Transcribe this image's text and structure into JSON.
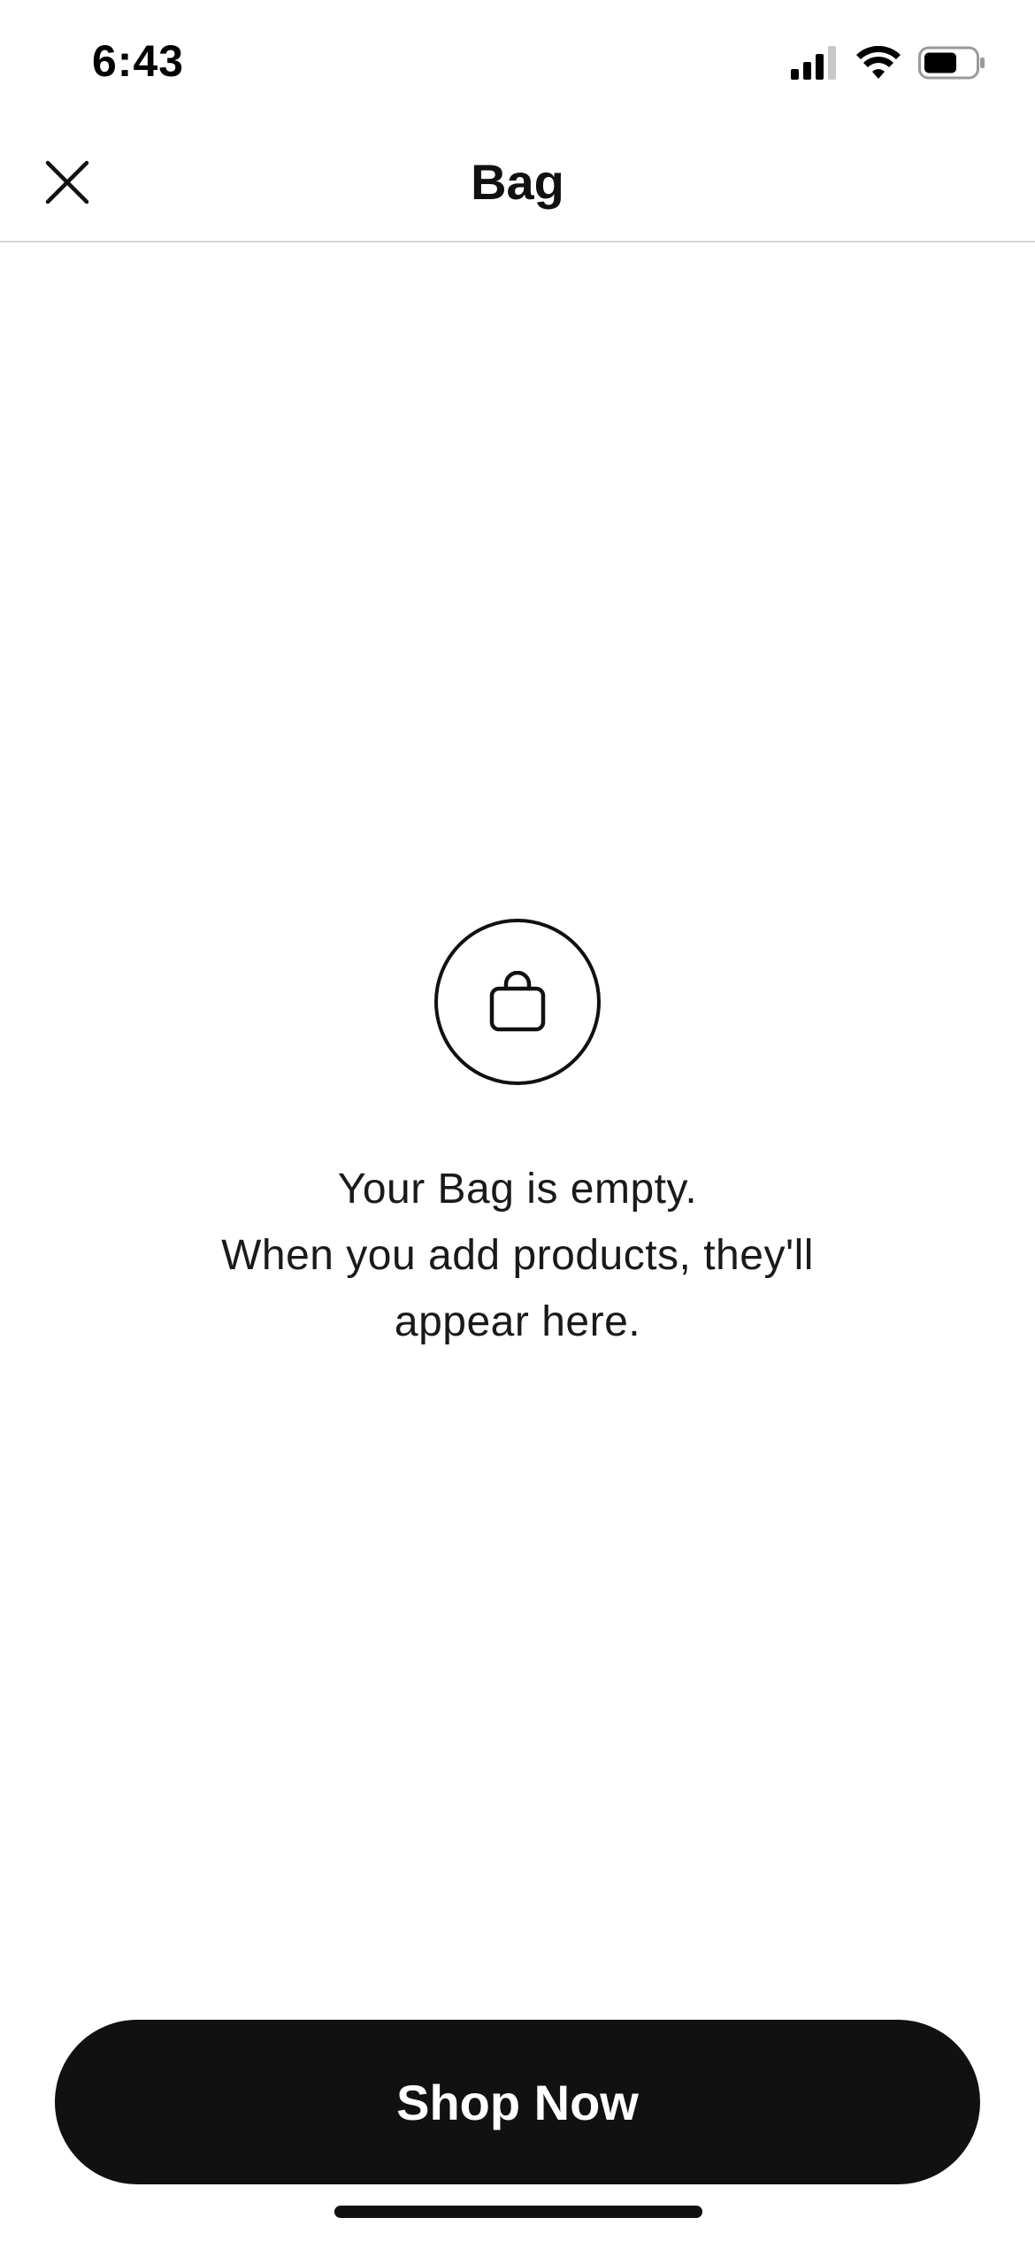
{
  "status_bar": {
    "time": "6:43",
    "icons": [
      "cellular-signal-icon",
      "wifi-icon",
      "battery-icon"
    ]
  },
  "header": {
    "title": "Bag",
    "close_icon": "close-icon"
  },
  "empty_state": {
    "icon": "shopping-bag-icon",
    "line1": "Your Bag is empty.",
    "line2": "When you add products, they'll",
    "line3": "appear here."
  },
  "actions": {
    "shop_now_label": "Shop Now"
  },
  "colors": {
    "background": "#ffffff",
    "text": "#111111",
    "button_background": "#111111",
    "button_text": "#ffffff",
    "divider": "#d6d6d6"
  }
}
